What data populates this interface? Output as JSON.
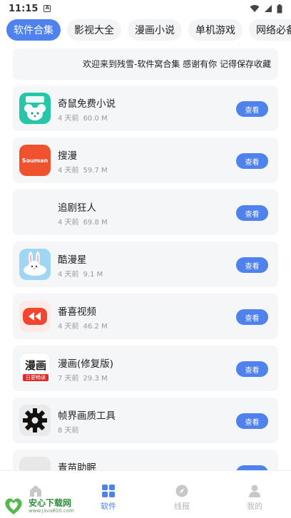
{
  "status_bar": {
    "time": "11:15"
  },
  "tabs": [
    {
      "label": "软件合集",
      "active": true
    },
    {
      "label": "影视大全",
      "active": false
    },
    {
      "label": "漫画小说",
      "active": false
    },
    {
      "label": "单机游戏",
      "active": false
    },
    {
      "label": "网络必备",
      "active": false
    }
  ],
  "notice": {
    "text": "欢迎来到残雪-软件窝合集 感谢有你 记得保存收藏"
  },
  "apps": [
    {
      "name": "奇鼠免费小说",
      "age": "4 天前",
      "size": "60.0 M",
      "button": "查看",
      "icon": "qishu-mouse-icon"
    },
    {
      "name": "搜漫",
      "age": "4 天前",
      "size": "59.7 M",
      "button": "查看",
      "icon": "souman-icon",
      "icon_text": "Souman"
    },
    {
      "name": "追剧狂人",
      "age": "4 天前",
      "size": "69.8 M",
      "button": "查看",
      "icon": "blank-icon"
    },
    {
      "name": "酷漫星",
      "age": "4 天前",
      "size": "9.1 M",
      "button": "查看",
      "icon": "bunny-icon"
    },
    {
      "name": "番喜视频",
      "age": "4 天前",
      "size": "46.2 M",
      "button": "查看",
      "icon": "rewind-icon"
    },
    {
      "name": "漫画(修复版)",
      "age": "7 天前",
      "size": "29.3 M",
      "button": "查看",
      "icon": "manhua-icon",
      "icon_text": "漫画",
      "icon_subtext": "日更畅读"
    },
    {
      "name": "帧界画质工具",
      "age": "8 天前",
      "size": "",
      "button": "查看",
      "icon": "gear-icon"
    },
    {
      "name": "青苗助眠",
      "age": "",
      "size": "",
      "button": "查看",
      "icon": "blank-icon"
    }
  ],
  "bottom_nav": [
    {
      "label": "",
      "icon": "home-icon",
      "active": false
    },
    {
      "label": "软件",
      "icon": "apps-grid-icon",
      "active": true
    },
    {
      "label": "线报",
      "icon": "compass-icon",
      "active": false
    },
    {
      "label": "我的",
      "icon": "user-icon",
      "active": false
    }
  ],
  "watermark": {
    "title": "安心下载网",
    "url": "www.java800.com"
  },
  "colors": {
    "accent": "#4f82ec",
    "card_bg": "#f5f6f8",
    "tab_bg": "#f3f4f6"
  }
}
